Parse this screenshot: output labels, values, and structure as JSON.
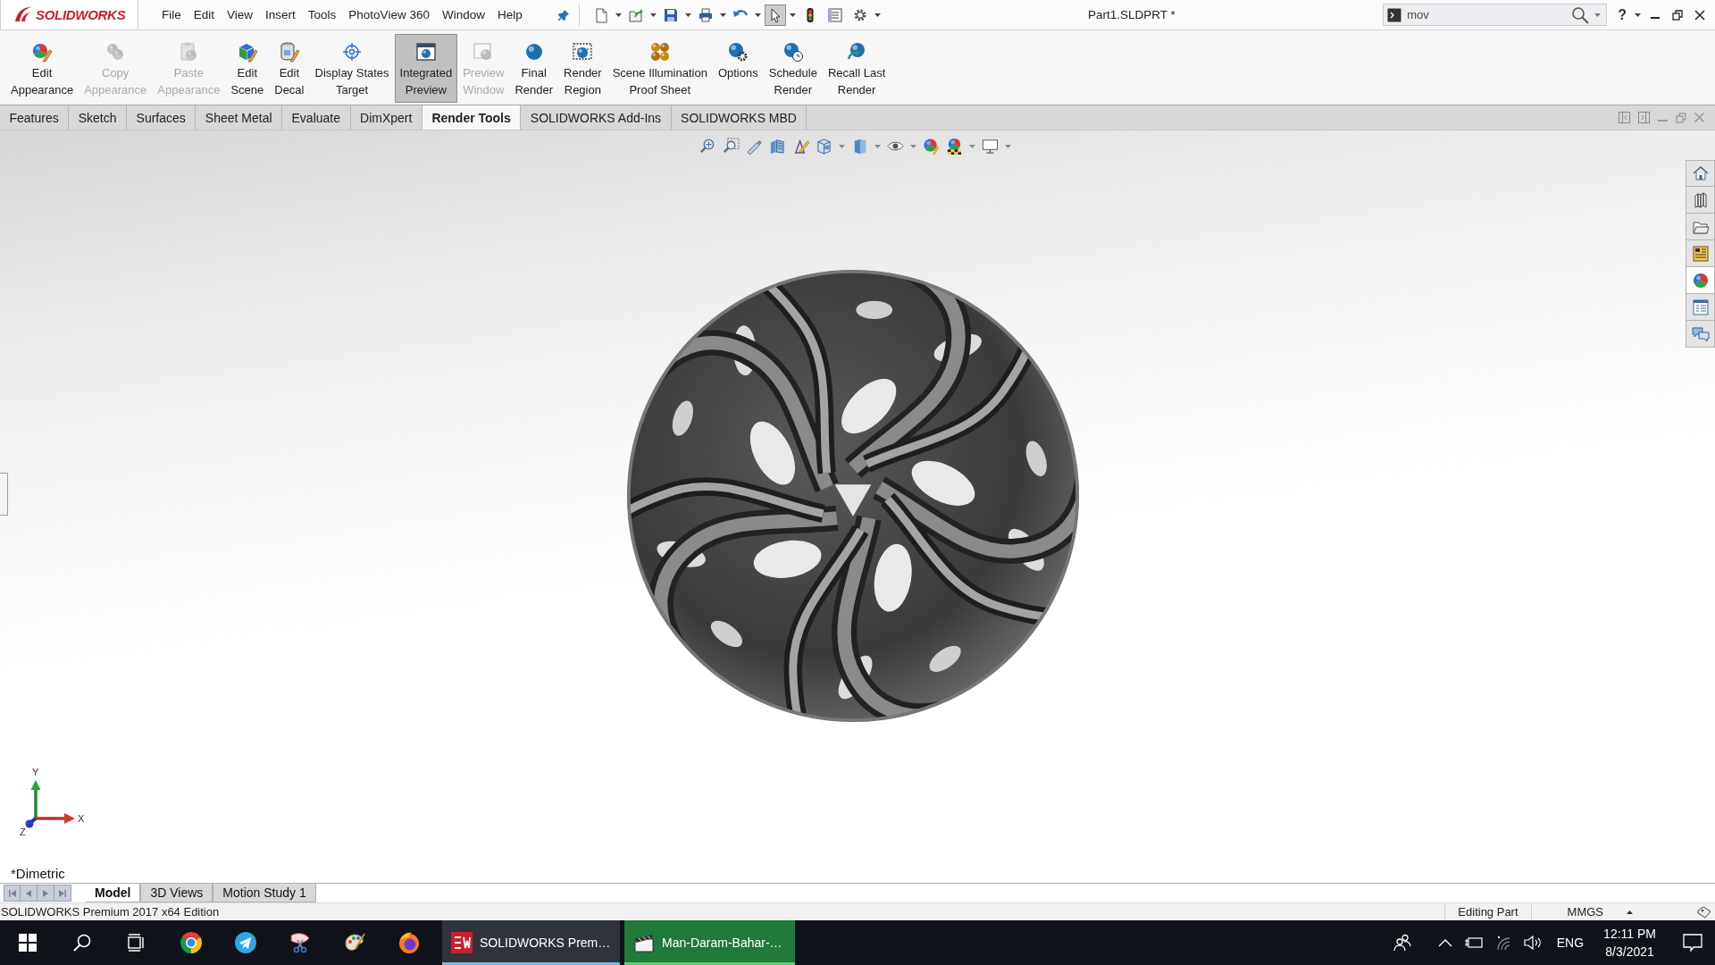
{
  "title_bar": {
    "logo": "SOLIDWORKS",
    "menu": [
      "File",
      "Edit",
      "View",
      "Insert",
      "Tools",
      "PhotoView 360",
      "Window",
      "Help"
    ],
    "quick_access": [
      {
        "pressed": false
      },
      {
        "pressed": false
      },
      {
        "pressed": false
      },
      {
        "pressed": false
      },
      {
        "pressed": false
      },
      {
        "pressed": true
      },
      {
        "pressed": false
      },
      {
        "pressed": false
      },
      {
        "pressed": false
      }
    ],
    "document_title": "Part1.SLDPRT *",
    "search": {
      "value": "mov"
    },
    "help": "?"
  },
  "ribbon": [
    {
      "lines": [
        "Edit",
        "Appearance"
      ],
      "disabled": false,
      "on": false
    },
    {
      "lines": [
        "Copy",
        "Appearance"
      ],
      "disabled": true,
      "on": false
    },
    {
      "lines": [
        "Paste",
        "Appearance"
      ],
      "disabled": true,
      "on": false
    },
    {
      "lines": [
        "Edit",
        "Scene"
      ],
      "disabled": false,
      "on": false
    },
    {
      "lines": [
        "Edit",
        "Decal"
      ],
      "disabled": false,
      "on": false
    },
    {
      "lines": [
        "Display States",
        "Target"
      ],
      "disabled": false,
      "on": false
    },
    {
      "lines": [
        "Integrated",
        "Preview"
      ],
      "disabled": false,
      "on": true
    },
    {
      "lines": [
        "Preview",
        "Window"
      ],
      "disabled": true,
      "on": false
    },
    {
      "lines": [
        "Final",
        "Render"
      ],
      "disabled": false,
      "on": false
    },
    {
      "lines": [
        "Render",
        "Region"
      ],
      "disabled": false,
      "on": false
    },
    {
      "lines": [
        "Scene Illumination",
        "Proof Sheet"
      ],
      "disabled": false,
      "on": false
    },
    {
      "lines": [
        "Options"
      ],
      "disabled": false,
      "on": false
    },
    {
      "lines": [
        "Schedule",
        "Render"
      ],
      "disabled": false,
      "on": false
    },
    {
      "lines": [
        "Recall Last",
        "Render"
      ],
      "disabled": false,
      "on": false
    }
  ],
  "command_tabs": [
    {
      "label": "Features",
      "selected": false
    },
    {
      "label": "Sketch",
      "selected": false
    },
    {
      "label": "Surfaces",
      "selected": false
    },
    {
      "label": "Sheet Metal",
      "selected": false
    },
    {
      "label": "Evaluate",
      "selected": false
    },
    {
      "label": "DimXpert",
      "selected": false
    },
    {
      "label": "Render Tools",
      "selected": true
    },
    {
      "label": "SOLIDWORKS Add-Ins",
      "selected": false
    },
    {
      "label": "SOLIDWORKS MBD",
      "selected": false
    }
  ],
  "viewport": {
    "task_pane": [
      {
        "selected": false
      },
      {
        "selected": false
      },
      {
        "selected": false
      },
      {
        "selected": false
      },
      {
        "selected": true
      },
      {
        "selected": false
      },
      {
        "selected": false
      }
    ],
    "triad": {
      "x": "X",
      "y": "Y",
      "z": "Z"
    },
    "view_name": "*Dimetric"
  },
  "bottom_tabs": [
    {
      "label": "Model",
      "selected": true
    },
    {
      "label": "3D Views",
      "selected": false
    },
    {
      "label": "Motion Study 1",
      "selected": false
    }
  ],
  "status_bar": {
    "edition": "SOLIDWORKS Premium 2017 x64 Edition",
    "mode": "Editing Part",
    "units": "MMGS"
  },
  "taskbar": {
    "apps": [
      {
        "label": "SOLIDWORKS Prem…",
        "active": true,
        "highlighted": false
      },
      {
        "label": "Man-Daram-Bahar-…",
        "active": false,
        "highlighted": true
      }
    ],
    "language": "ENG",
    "time": "12:11 PM",
    "date": "8/3/2021"
  }
}
